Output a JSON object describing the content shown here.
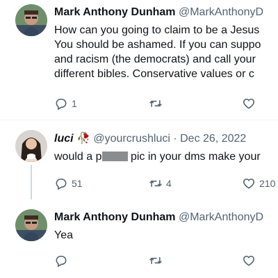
{
  "tweets": [
    {
      "name": "Mark Anthony Dunham",
      "handle": "@MarkAnthonyD",
      "lines": [
        "How can you going to claim to be a Jesus",
        "You should be ashamed. If you can suppo",
        "and racism (the democrats) and call your",
        "different bibles. Conservative values or c"
      ],
      "replies": "1",
      "retweets": "",
      "likes": ""
    },
    {
      "name": "luci",
      "emoji": "🥀",
      "handle": "@yourcrushluci",
      "date": "· Dec 26, 2022",
      "text_before": "would a p",
      "text_after": " pic in your dms make your",
      "replies": "51",
      "retweets": "4",
      "likes": "210"
    },
    {
      "name": "Mark Anthony Dunham",
      "handle": "@MarkAnthonyD",
      "lines": [
        "Yea"
      ],
      "replies": "",
      "retweets": "",
      "likes": ""
    }
  ],
  "colors": {
    "text": "#0f1419",
    "muted": "#536471",
    "divider": "#eff3f4"
  },
  "icons": [
    "reply-icon",
    "retweet-icon",
    "like-icon",
    "rose-emoji"
  ]
}
